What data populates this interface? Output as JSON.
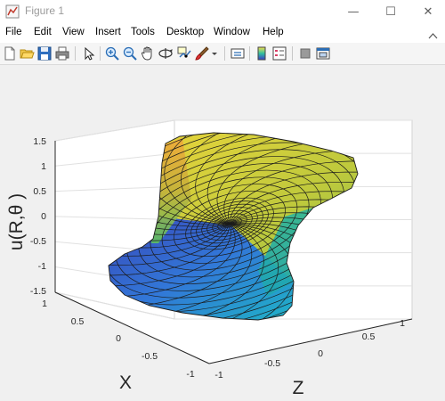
{
  "window": {
    "title": "Figure 1",
    "controls": {
      "minimize": "—",
      "maximize": "☐",
      "close": "✕"
    }
  },
  "menu": [
    "File",
    "Edit",
    "View",
    "Insert",
    "Tools",
    "Desktop",
    "Window",
    "Help"
  ],
  "toolbar_icons": [
    "new-figure-icon",
    "open-file-icon",
    "save-icon",
    "print-icon",
    "edit-plot-arrow-icon",
    "zoom-in-icon",
    "zoom-out-icon",
    "pan-hand-icon",
    "rotate-3d-icon",
    "data-cursor-icon",
    "brush-icon",
    "brush-dropdown-icon",
    "link-plot-icon",
    "colorbar-icon",
    "legend-icon",
    "hide-tools-icon",
    "dock-icon"
  ],
  "plot": {
    "zlabel": "u(R,θ )",
    "xlabel": "X",
    "ylabel": "Z",
    "z_ticks": [
      "1.5",
      "1",
      "0.5",
      "0",
      "-0.5",
      "-1",
      "-1.5"
    ],
    "x_ticks": [
      "1",
      "0.5",
      "0",
      "-0.5",
      "-1"
    ],
    "y_ticks": [
      "-1",
      "-0.5",
      "0",
      "0.5",
      "1"
    ],
    "colormap": [
      "#440154",
      "#3b528b",
      "#21918c",
      "#5ec962",
      "#fde725"
    ]
  },
  "chart_data": {
    "type": "surface",
    "function": "u(R,θ) on unit disk",
    "zlabel": "u(R,θ )",
    "xlabel": "X",
    "ylabel": "Z",
    "xlim": [
      -1,
      1
    ],
    "ylim": [
      -1,
      1
    ],
    "zlim": [
      -1.5,
      1.5
    ],
    "grid": true,
    "colormap": "parula"
  }
}
